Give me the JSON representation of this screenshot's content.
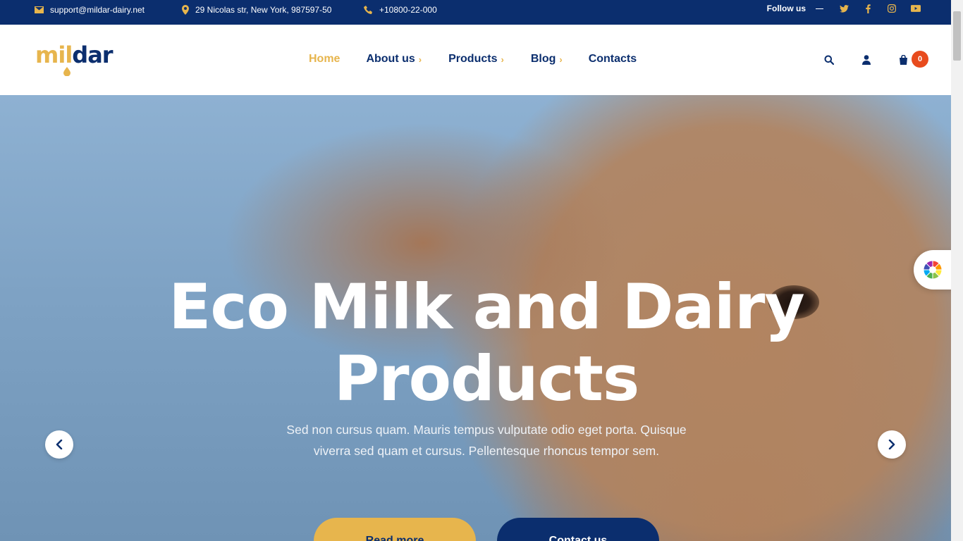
{
  "topbar": {
    "email": "support@mildar-dairy.net",
    "address": "29 Nicolas str, New York, 987597-50",
    "phone": "+10800-22-000",
    "follow_label": "Follow us",
    "social_icons": [
      "twitter-icon",
      "facebook-icon",
      "instagram-icon",
      "youtube-icon"
    ]
  },
  "header": {
    "logo": {
      "part1": "mil",
      "part2": "dar"
    },
    "nav": [
      {
        "label": "Home",
        "active": true,
        "has_submenu": false
      },
      {
        "label": "About us",
        "active": false,
        "has_submenu": true
      },
      {
        "label": "Products",
        "active": false,
        "has_submenu": true
      },
      {
        "label": "Blog",
        "active": false,
        "has_submenu": true
      },
      {
        "label": "Contacts",
        "active": false,
        "has_submenu": false
      }
    ],
    "cart_count": "0"
  },
  "hero": {
    "title_line1": "Eco Milk and Dairy",
    "title_line2": "Products",
    "subtitle": "Sed non cursus quam. Mauris tempus vulputate odio eget porta. Quisque viverra sed quam et cursus. Pellentesque rhoncus tempor sem.",
    "buttons": {
      "read_more": "Read more",
      "contact": "Contact us"
    }
  },
  "colors": {
    "navy": "#0b2e6e",
    "gold": "#e7b54d",
    "badge": "#e84b1d"
  }
}
